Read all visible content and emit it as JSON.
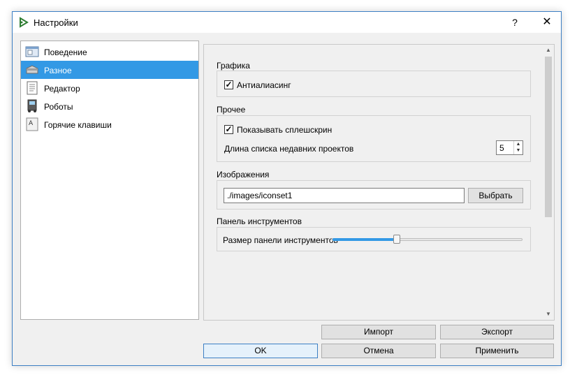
{
  "window": {
    "title": "Настройки",
    "help_label": "?",
    "close_label": "✕"
  },
  "sidebar": {
    "items": [
      {
        "label": "Поведение",
        "icon": "behavior-icon",
        "selected": false
      },
      {
        "label": "Разное",
        "icon": "misc-icon",
        "selected": true
      },
      {
        "label": "Редактор",
        "icon": "editor-icon",
        "selected": false
      },
      {
        "label": "Роботы",
        "icon": "robots-icon",
        "selected": false
      },
      {
        "label": "Горячие клавиши",
        "icon": "hotkeys-icon",
        "selected": false
      }
    ]
  },
  "graphics": {
    "title": "Графика",
    "antialiasing_label": "Антиалиасинг",
    "antialiasing_checked": true
  },
  "other": {
    "title": "Прочее",
    "splash_label": "Показывать сплешскрин",
    "splash_checked": true,
    "recent_label": "Длина списка недавних проектов",
    "recent_value": "5"
  },
  "images": {
    "title": "Изображения",
    "path_value": "./images/iconset1",
    "choose_label": "Выбрать"
  },
  "toolbar_panel": {
    "title": "Панель инструментов",
    "size_label": "Размер панели инструментов",
    "size_fraction": 0.34
  },
  "buttons": {
    "import_label": "Импорт",
    "export_label": "Экспорт",
    "ok_label": "OK",
    "cancel_label": "Отмена",
    "apply_label": "Применить"
  },
  "colors": {
    "accent": "#3399e5",
    "window_border": "#3c7fc4"
  }
}
